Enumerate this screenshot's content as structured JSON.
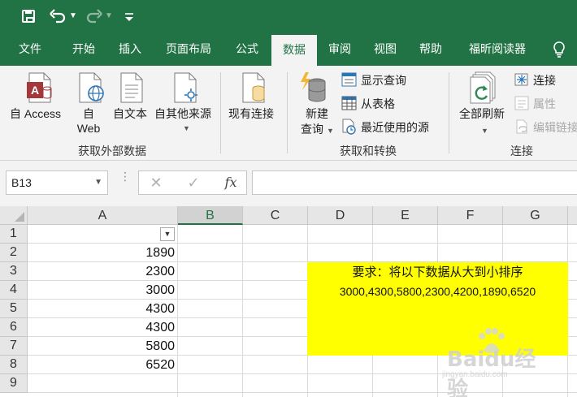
{
  "quick_access": {
    "save_icon": "save-icon",
    "undo_icon": "undo-icon",
    "redo_icon": "redo-icon",
    "customize_icon": "customize-qat-icon"
  },
  "tabs": [
    {
      "label": "文件",
      "active": false
    },
    {
      "label": "开始",
      "active": false
    },
    {
      "label": "插入",
      "active": false
    },
    {
      "label": "页面布局",
      "active": false
    },
    {
      "label": "公式",
      "active": false
    },
    {
      "label": "数据",
      "active": true
    },
    {
      "label": "审阅",
      "active": false
    },
    {
      "label": "视图",
      "active": false
    },
    {
      "label": "帮助",
      "active": false
    },
    {
      "label": "福昕阅读器",
      "active": false
    }
  ],
  "ribbon": {
    "get_external": {
      "from_access": "自 Access",
      "from_web_1": "自",
      "from_web_2": "Web",
      "from_text": "自文本",
      "from_other": "自其他来源",
      "group_label": "获取外部数据"
    },
    "existing_connections": "现有连接",
    "get_transform": {
      "new_query_1": "新建",
      "new_query_2": "查询",
      "show_queries": "显示查询",
      "from_table": "从表格",
      "recent_sources": "最近使用的源",
      "group_label": "获取和转换"
    },
    "connections": {
      "refresh_all": "全部刷新",
      "connections": "连接",
      "properties": "属性",
      "edit_links": "编辑链接",
      "group_label": "连接"
    }
  },
  "formula_bar": {
    "name_box": "B13",
    "cancel": "✕",
    "enter": "✓",
    "fx": "fx",
    "value": ""
  },
  "grid": {
    "columns": [
      "A",
      "B",
      "C",
      "D",
      "E",
      "F",
      "G"
    ],
    "selected_column": "B",
    "rows": [
      "1",
      "2",
      "3",
      "4",
      "5",
      "6",
      "7",
      "8",
      "9"
    ],
    "column_a_values": [
      "",
      "1890",
      "2300",
      "3000",
      "4300",
      "4300",
      "5800",
      "6520",
      ""
    ],
    "note_line_1": "要求：将以下数据从大到小排序",
    "note_line_2": "3000,4300,5800,2300,4200,1890,6520",
    "note_color": "#ffff00"
  },
  "watermark": {
    "brand": "Baidu经验",
    "sub": "jingyan.baidu.com"
  },
  "colors": {
    "accent": "#217346",
    "ribbon_bg": "#f3f3f3"
  }
}
